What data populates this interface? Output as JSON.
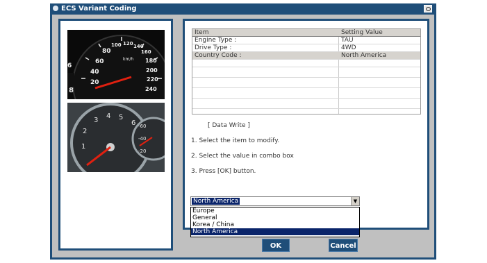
{
  "window": {
    "title": "ECS Variant Coding"
  },
  "table": {
    "headers": [
      "Item",
      "Setting Value"
    ],
    "rows": [
      [
        "Engine Type :",
        "TAU"
      ],
      [
        "Drive Type :",
        "4WD"
      ],
      [
        "Country Code :",
        "North America"
      ]
    ],
    "selected_row": 2
  },
  "instructions": {
    "title": "[ Data Write ]",
    "step1": "1. Select the item to modify.",
    "step2": "2. Select the value in combo box",
    "step3": "3. Press [OK] button."
  },
  "combo": {
    "value": "North America",
    "options": [
      "Europe",
      "General",
      "Korea / China",
      "North America"
    ],
    "selected_index": 3
  },
  "buttons": {
    "ok": "OK",
    "cancel": "Cancel"
  },
  "images": {
    "speedometer_labels": [
      "80",
      "100",
      "120",
      "140",
      "160",
      "180",
      "200",
      "220",
      "240",
      "60",
      "40",
      "20",
      "km/h"
    ],
    "tachometer_labels": [
      "2",
      "3",
      "4",
      "5",
      "6",
      "1",
      "-60",
      "-40",
      "-20"
    ]
  }
}
